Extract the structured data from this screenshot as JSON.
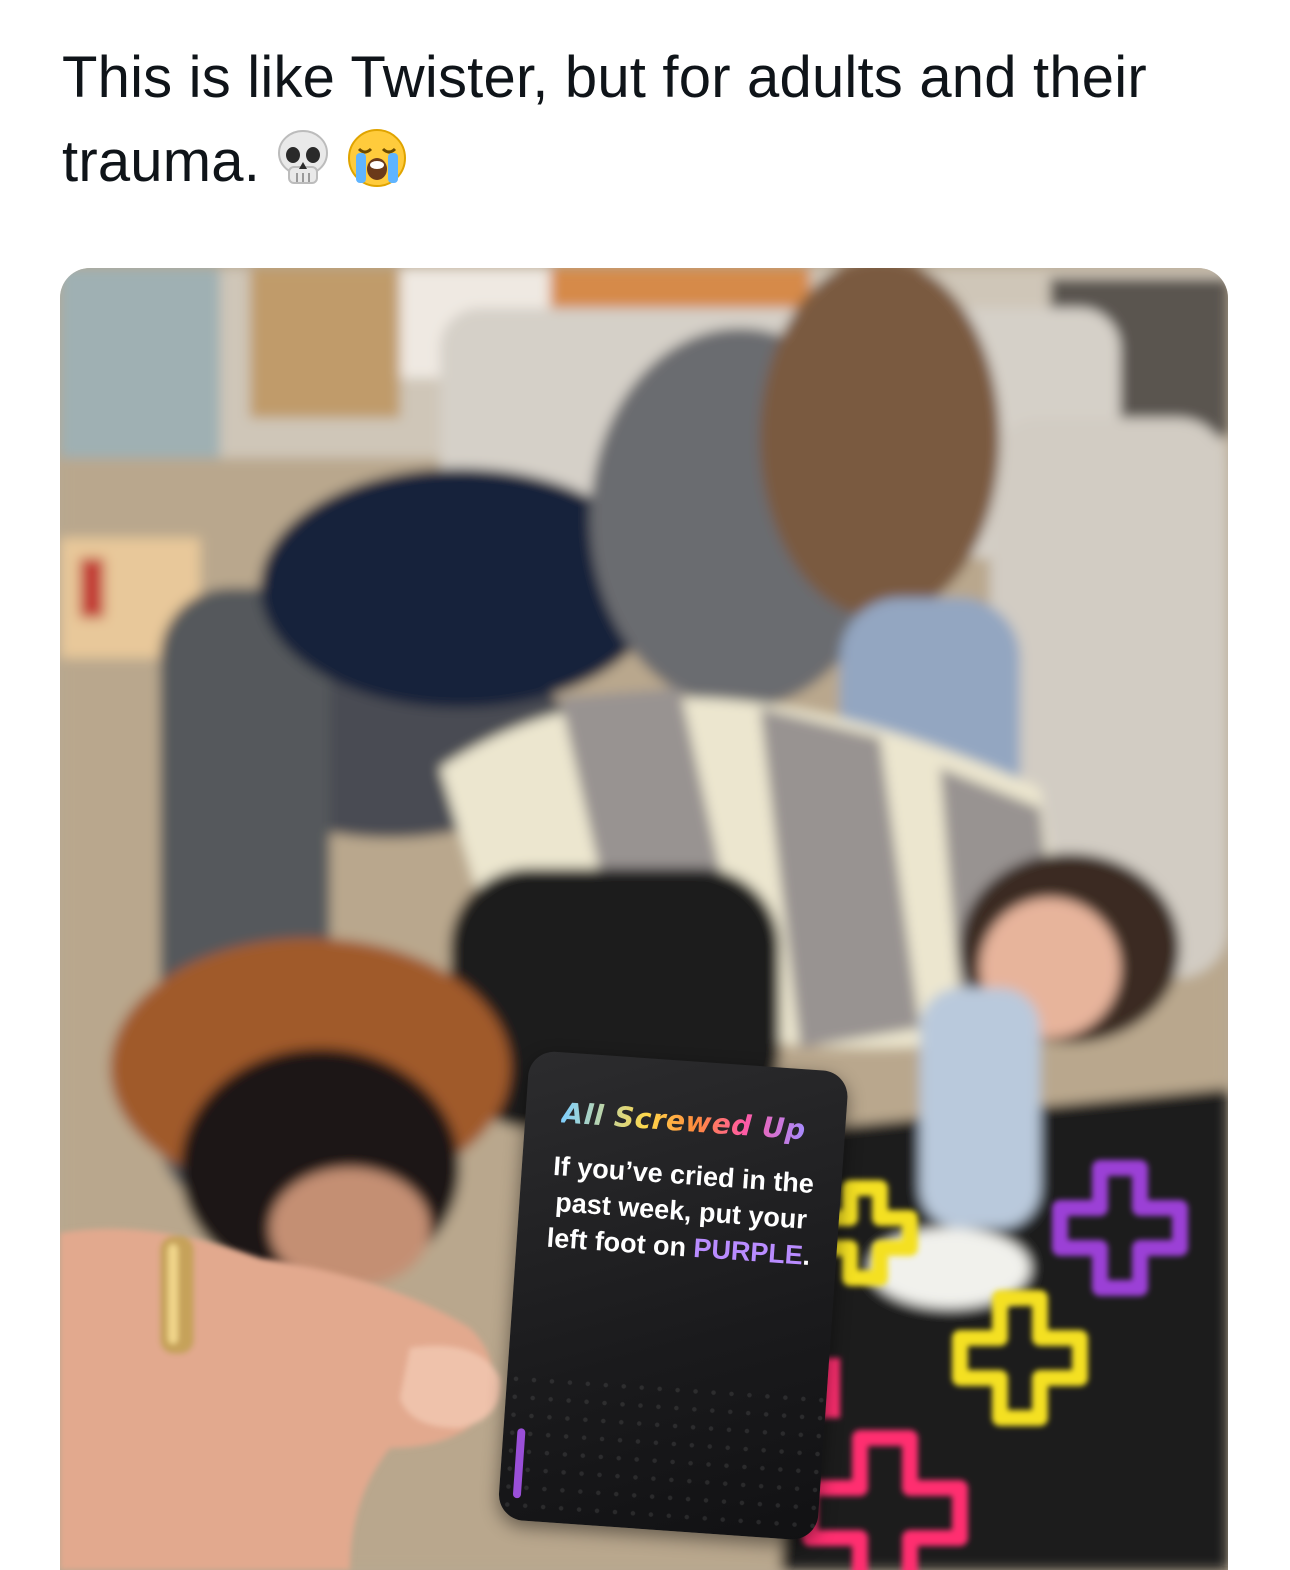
{
  "post": {
    "text": "This is like Twister, but for adults and their trauma.",
    "emojis": [
      "skull-emoji",
      "loudly-crying-face-emoji"
    ]
  },
  "card": {
    "logo_text": "All Screwed Up",
    "text_before": "If you’ve cried in the past week, put your left foot on ",
    "highlight": "PURPLE",
    "text_after": "."
  },
  "colors": {
    "text": "#0f1419",
    "card_bg": "#1c1c1e",
    "highlight_purple": "#b98cff",
    "mat_yellow": "#f4e020",
    "mat_pink": "#ff2d6f",
    "mat_purple": "#9b3fd6"
  }
}
